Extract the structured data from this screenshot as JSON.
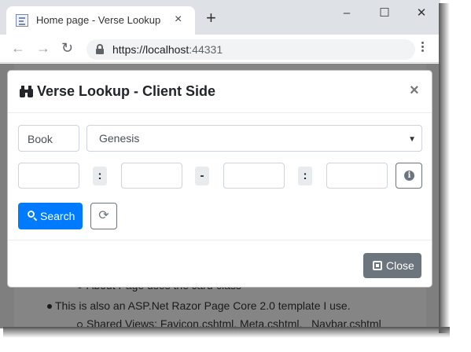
{
  "browser": {
    "tab_title": "Home page - Verse Lookup",
    "tab_close": "×",
    "new_tab": "+",
    "url_host": "https://localhost",
    "url_port": ":44331",
    "controls": {
      "minimize": "–",
      "maximize": "☐",
      "close": "✕"
    },
    "nav": {
      "back": "←",
      "forward": "→",
      "reload": "↻"
    }
  },
  "page": {
    "line1_prefix": "About Page uses the ",
    "line1_em": "card",
    "line1_suffix": " class",
    "line2": "This is also an ASP.Net Razor Page Core 2.0 template I use.",
    "line3": "Shared Views: Favicon.cshtml, Meta.cshtml, _Navbar.cshtml"
  },
  "modal": {
    "title": "Verse Lookup - Client Side",
    "close_x": "×",
    "book_label": "Book",
    "book_selected": "Genesis",
    "separators": [
      ":",
      "-",
      ":"
    ],
    "fields": [
      "",
      "",
      "",
      ""
    ],
    "info_glyph": "i",
    "search_label": "Search",
    "refresh_glyph": "⟳",
    "close_label": "Close"
  },
  "colors": {
    "primary": "#007bff",
    "secondary": "#6c757d",
    "backdrop": "#7f7f7f"
  }
}
